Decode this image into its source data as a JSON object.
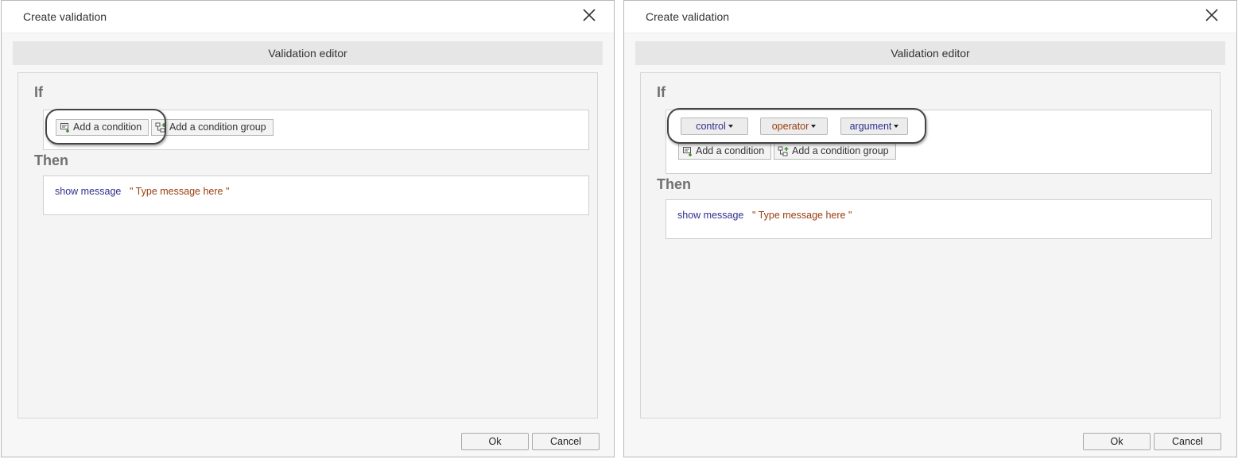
{
  "colors": {
    "control": "#2f2f8f",
    "operator": "#9a3c0e",
    "argument": "#2f2f8f",
    "message_keyword": "#2f2f8f",
    "message_value": "#9a3c0e"
  },
  "dialogs": [
    {
      "title": "Create validation",
      "editor_header": "Validation editor",
      "if_label": "If",
      "then_label": "Then",
      "condition_dropdowns": [],
      "add_condition_label": "Add a condition",
      "add_condition_group_label": "Add a condition group",
      "action_keyword": "show message",
      "action_value": "\" Type message here \"",
      "ok_label": "Ok",
      "cancel_label": "Cancel"
    },
    {
      "title": "Create validation",
      "editor_header": "Validation editor",
      "if_label": "If",
      "then_label": "Then",
      "condition_dropdowns": [
        "control",
        "operator",
        "argument"
      ],
      "add_condition_label": "Add a condition",
      "add_condition_group_label": "Add a condition group",
      "action_keyword": "show message",
      "action_value": "\" Type message here \"",
      "ok_label": "Ok",
      "cancel_label": "Cancel"
    }
  ]
}
